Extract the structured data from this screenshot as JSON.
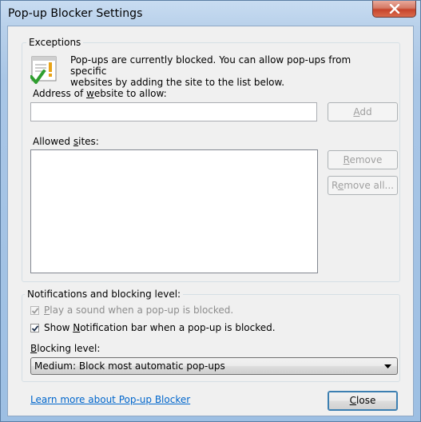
{
  "window": {
    "title": "Pop-up Blocker Settings",
    "close_icon": "close-icon"
  },
  "exceptions": {
    "legend": "Exceptions",
    "info_icon": "notepad-warning-check-icon",
    "info_line1": "Pop-ups are currently blocked.  You can allow pop-ups from specific",
    "info_line2": "websites by adding the site to the list below.",
    "address_label_pre": "Address of ",
    "address_label_key": "w",
    "address_label_post": "ebsite to allow:",
    "address_value": "",
    "add_key": "A",
    "add_rest": "dd",
    "allowed_label_pre": "Allowed ",
    "allowed_label_key": "s",
    "allowed_label_post": "ites:",
    "allowed_sites": [],
    "remove_key": "R",
    "remove_rest": "emove",
    "remove_all_pre": "R",
    "remove_all_key": "e",
    "remove_all_post": "move all..."
  },
  "notifications": {
    "legend": "Notifications and blocking level:",
    "play_sound_key": "P",
    "play_sound_rest": "lay a sound when a pop-up is blocked.",
    "play_sound_checked": true,
    "play_sound_disabled": true,
    "show_bar_pre": "Show ",
    "show_bar_key": "N",
    "show_bar_post": "otification bar when a pop-up is blocked.",
    "show_bar_checked": true,
    "blocking_label_key": "B",
    "blocking_label_rest": "locking level:",
    "blocking_level": "Medium: Block most automatic pop-ups"
  },
  "footer": {
    "learn_more": "Learn more about Pop-up Blocker",
    "close_key": "C",
    "close_rest": "lose"
  }
}
